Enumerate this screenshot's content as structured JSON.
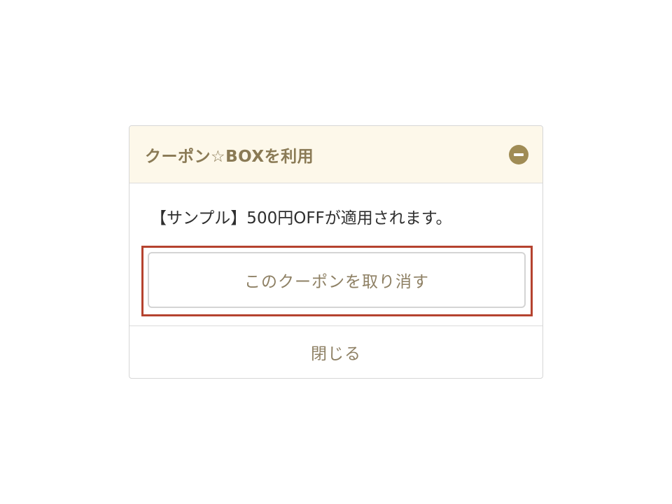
{
  "coupon_panel": {
    "title": "クーポン☆BOXを利用",
    "collapse_icon": "minus-circle-icon",
    "message": "【サンプル】500円OFFが適用されます。",
    "cancel_label": "このクーポンを取り消す",
    "close_label": "閉じる"
  },
  "colors": {
    "header_bg": "#fdf8ea",
    "accent": "#a08c55",
    "highlight_border": "#b5432f",
    "button_text": "#8e8064"
  }
}
